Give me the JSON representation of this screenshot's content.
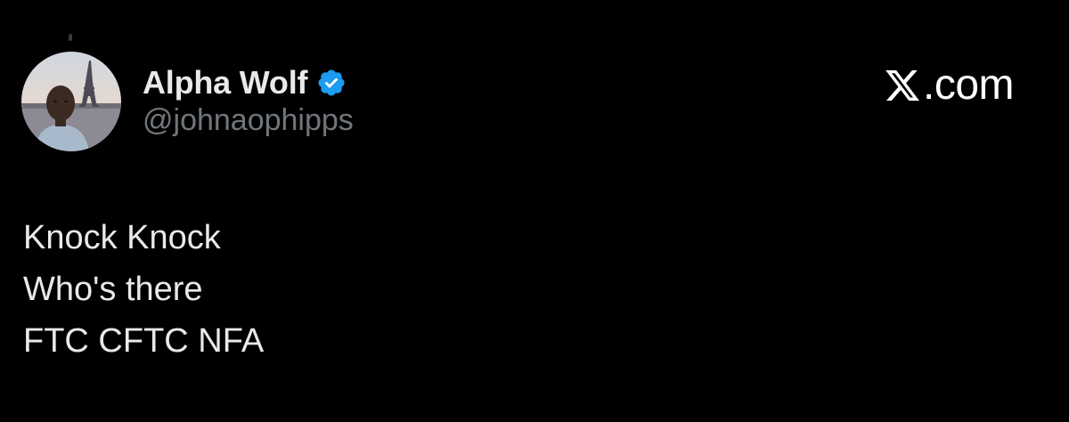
{
  "author": {
    "display_name": "Alpha Wolf",
    "handle": "@johnaophipps",
    "verified": true,
    "avatar": "profile-photo-eiffel-tower"
  },
  "brand": {
    "icon": "x-logo-icon",
    "text": ".com"
  },
  "tweet": {
    "lines": [
      "Knock Knock",
      "Who's there",
      "FTC CFTC NFA"
    ]
  },
  "colors": {
    "background": "#000000",
    "primary_text": "#e7e9ea",
    "secondary_text": "#71767b",
    "verified_blue": "#1d9bf0"
  }
}
